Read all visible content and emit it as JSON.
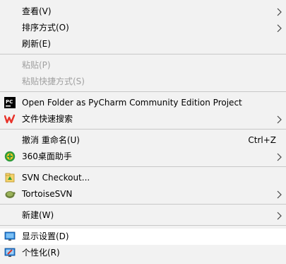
{
  "menu": {
    "view_label": "查看(V)",
    "sort_label": "排序方式(O)",
    "refresh_label": "刷新(E)",
    "paste_label": "粘贴(P)",
    "paste_shortcut_label": "粘贴快捷方式(S)",
    "pycharm_label": "Open Folder as PyCharm Community Edition Project",
    "wps_search_label": "文件快速搜索",
    "undo_label": "撤消 重命名(U)",
    "undo_shortcut": "Ctrl+Z",
    "desktop_assistant_label": "360桌面助手",
    "svn_checkout_label": "SVN Checkout...",
    "tortoisesvn_label": "TortoiseSVN",
    "new_label": "新建(W)",
    "display_settings_label": "显示设置(D)",
    "personalize_label": "个性化(R)"
  },
  "icons": {
    "pycharm": "pycharm-icon",
    "wps": "wps-search-icon",
    "desktop_assistant": "360-desktop-icon",
    "svn_checkout": "svn-checkout-icon",
    "tortoisesvn": "tortoisesvn-icon",
    "display": "display-settings-icon",
    "personalize": "personalize-icon",
    "submenu": "chevron-right-icon"
  },
  "colors": {
    "menu_background": "#f2f2f2",
    "hover_background": "#ffffff",
    "disabled_text": "#a0a0a0",
    "separator": "#c8c8c8",
    "wps_red": "#e8332a",
    "svn_green": "#2e9b3a"
  }
}
